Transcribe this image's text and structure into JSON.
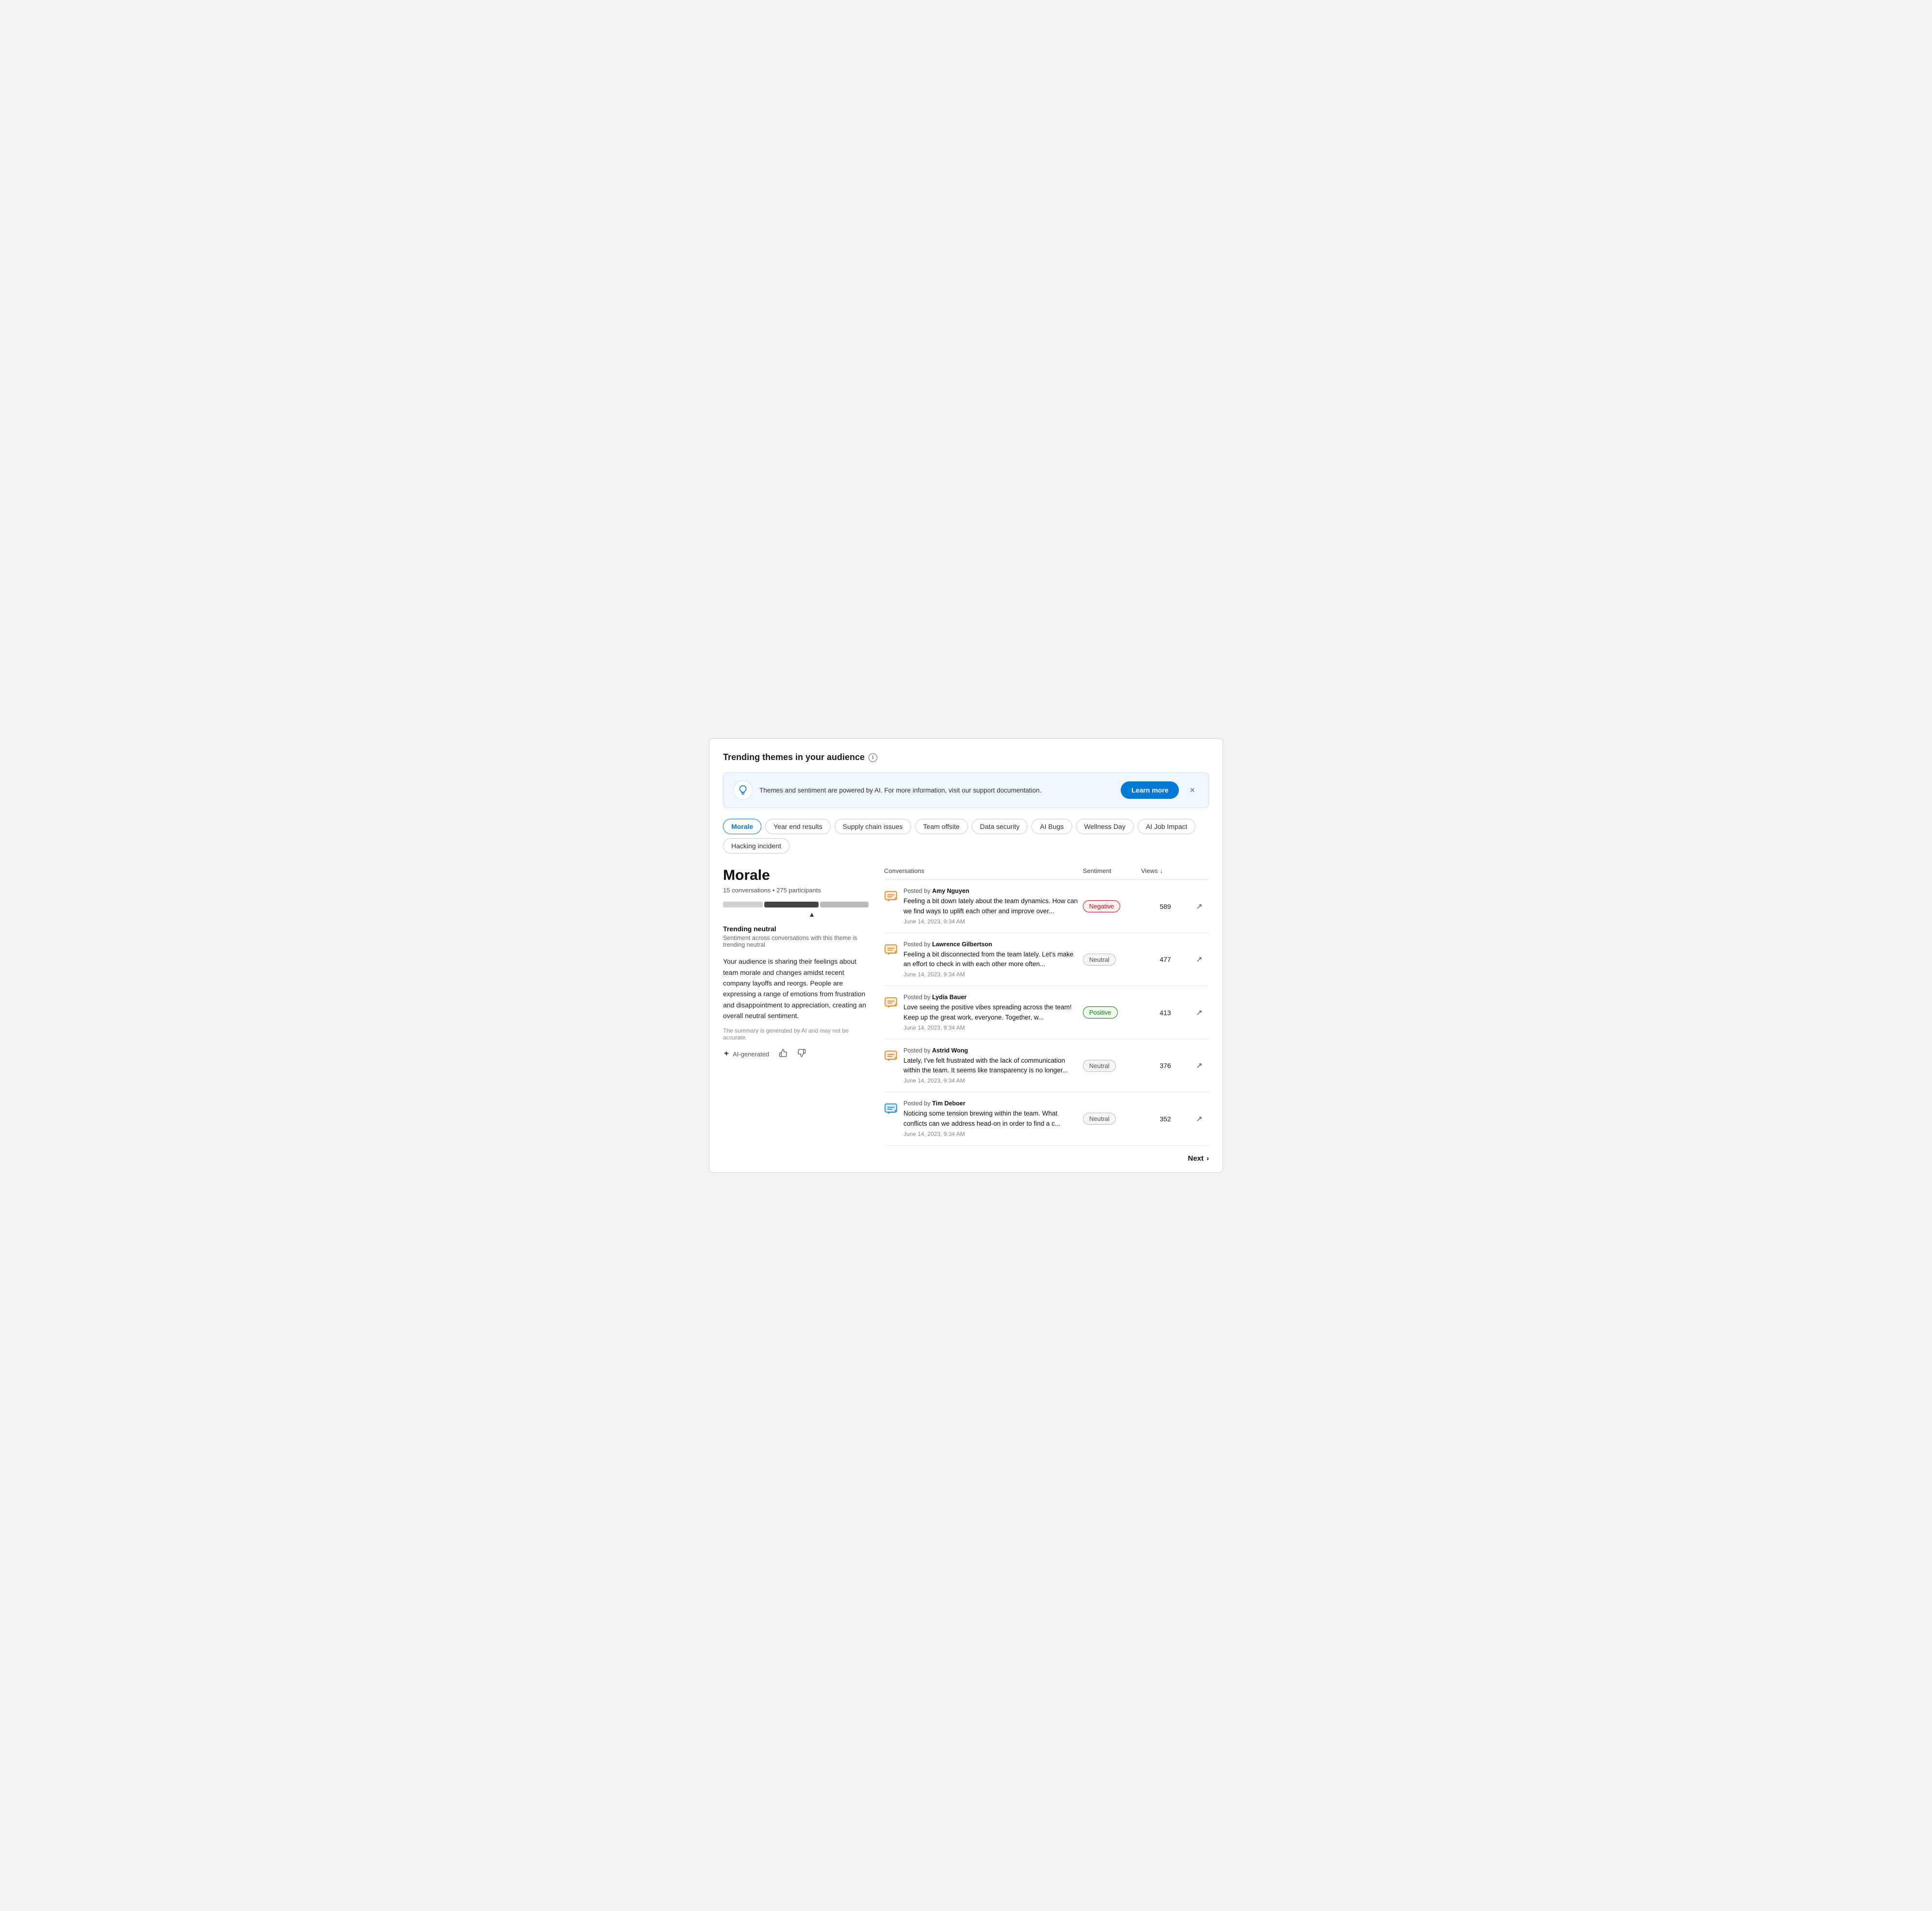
{
  "page": {
    "title": "Trending themes in your audience"
  },
  "banner": {
    "text": "Themes and sentiment are powered by AI. For more information, visit our support documentation.",
    "learn_more_label": "Learn more",
    "close_label": "×"
  },
  "tabs": [
    {
      "id": "morale",
      "label": "Morale",
      "active": true
    },
    {
      "id": "year-end-results",
      "label": "Year end results",
      "active": false
    },
    {
      "id": "supply-chain-issues",
      "label": "Supply chain issues",
      "active": false
    },
    {
      "id": "team-offsite",
      "label": "Team offsite",
      "active": false
    },
    {
      "id": "data-security",
      "label": "Data security",
      "active": false
    },
    {
      "id": "ai-bugs",
      "label": "AI Bugs",
      "active": false
    },
    {
      "id": "wellness-day",
      "label": "Wellness Day",
      "active": false
    },
    {
      "id": "ai-job-impact",
      "label": "AI Job Impact",
      "active": false
    },
    {
      "id": "hacking-incident",
      "label": "Hacking incident",
      "active": false
    }
  ],
  "theme": {
    "title": "Morale",
    "conversations": "15 conversations",
    "participants": "275 participants",
    "trending_label": "Trending neutral",
    "trending_sub": "Sentiment across conversations with this theme is trending neutral",
    "description": "Your audience is sharing their feelings about team morale and changes amidst recent company layoffs and reorgs. People are expressing a range of emotions from frustration and disappointment to appreciation, creating an overall neutral sentiment.",
    "disclaimer": "The summary is generated by AI and may not be accurate.",
    "ai_badge": "AI-generated",
    "thumbup_label": "👍",
    "thumbdown_label": "👎"
  },
  "table": {
    "col_conversations": "Conversations",
    "col_sentiment": "Sentiment",
    "col_views": "Views",
    "rows": [
      {
        "author": "Amy Nguyen",
        "text": "Feeling a bit down lately about the team dynamics. How can we find ways to uplift each other and improve over...",
        "date": "June 14, 2023, 9:34 AM",
        "sentiment": "Negative",
        "sentiment_type": "negative",
        "views": "589",
        "icon_color": "orange"
      },
      {
        "author": "Lawrence Gilbertson",
        "text": "Feeling a bit disconnected from the team lately. Let's make an effort to check in with each other more often...",
        "date": "June 14, 2023, 9:34 AM",
        "sentiment": "Neutral",
        "sentiment_type": "neutral",
        "views": "477",
        "icon_color": "orange"
      },
      {
        "author": "Lydia Bauer",
        "text": "Love seeing the positive vibes spreading across the team! Keep up the great work, everyone. Together, w...",
        "date": "June 14, 2023, 9:34 AM",
        "sentiment": "Positive",
        "sentiment_type": "positive",
        "views": "413",
        "icon_color": "orange"
      },
      {
        "author": "Astrid Wong",
        "text": "Lately, I've felt frustrated with the lack of communication within the team. It seems like transparency is no longer...",
        "date": "June 14, 2023, 9:34 AM",
        "sentiment": "Neutral",
        "sentiment_type": "neutral",
        "views": "376",
        "icon_color": "orange"
      },
      {
        "author": "Tim Deboer",
        "text": "Noticing some tension brewing within the team. What conflicts can we address head-on in order to find a c...",
        "date": "June 14, 2023, 9:34 AM",
        "sentiment": "Neutral",
        "sentiment_type": "neutral",
        "views": "352",
        "icon_color": "blue"
      }
    ]
  },
  "next_btn": "Next"
}
